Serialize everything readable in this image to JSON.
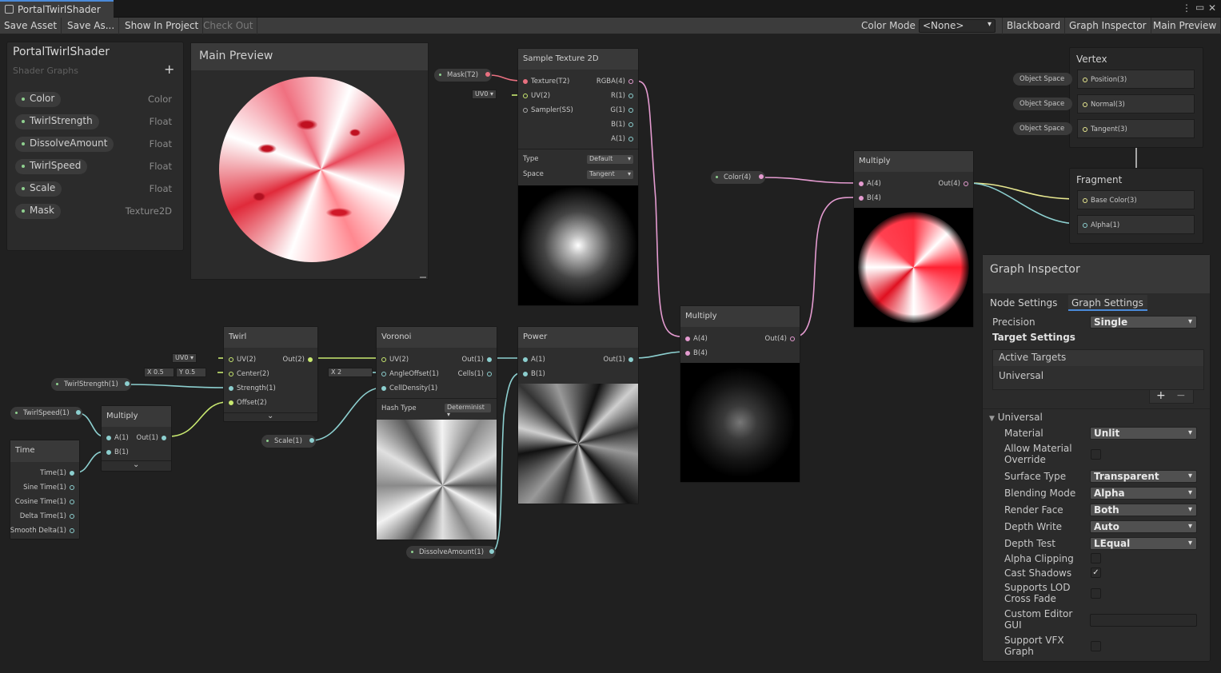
{
  "window": {
    "tab_title": "PortalTwirlShader",
    "menu_icon": "kebab-icon",
    "maximize_icon": "maximize-icon",
    "close_icon": "close-icon"
  },
  "toolbar": {
    "save_asset": "Save Asset",
    "save_as": "Save As...",
    "show_in_project": "Show In Project",
    "check_out": "Check Out",
    "color_mode_label": "Color Mode",
    "color_mode_value": "<None>",
    "blackboard": "Blackboard",
    "graph_inspector": "Graph Inspector",
    "main_preview": "Main Preview"
  },
  "blackboard": {
    "title": "PortalTwirlShader",
    "subtitle": "Shader Graphs",
    "add": "+",
    "properties": [
      {
        "name": "Color",
        "type": "Color"
      },
      {
        "name": "TwirlStrength",
        "type": "Float"
      },
      {
        "name": "DissolveAmount",
        "type": "Float"
      },
      {
        "name": "TwirlSpeed",
        "type": "Float"
      },
      {
        "name": "Scale",
        "type": "Float"
      },
      {
        "name": "Mask",
        "type": "Texture2D"
      }
    ]
  },
  "main_preview": {
    "title": "Main Preview"
  },
  "nodes": {
    "sample_texture": {
      "title": "Sample Texture 2D",
      "inputs": [
        "Texture(T2)",
        "UV(2)",
        "Sampler(SS)"
      ],
      "outputs": [
        "RGBA(4)",
        "R(1)",
        "G(1)",
        "B(1)",
        "A(1)"
      ],
      "type_label": "Type",
      "type_value": "Default",
      "space_label": "Space",
      "space_value": "Tangent"
    },
    "mask_pill": "Mask(T2)",
    "uv0_a": "UV0 ▾",
    "color_pill": "Color(4)",
    "multiply_top": {
      "title": "Multiply",
      "a": "A(4)",
      "b": "B(4)",
      "out": "Out(4)"
    },
    "vertex": {
      "title": "Vertex",
      "ports": [
        "Position(3)",
        "Normal(3)",
        "Tangent(3)"
      ],
      "space": "Object Space"
    },
    "fragment": {
      "title": "Fragment",
      "ports": [
        "Base Color(3)",
        "Alpha(1)"
      ]
    },
    "twirl": {
      "title": "Twirl",
      "inputs": [
        "UV(2)",
        "Center(2)",
        "Strength(1)",
        "Offset(2)"
      ],
      "out": "Out(2)",
      "uv0": "UV0 ▾",
      "x_label": "X",
      "x_value": "0.5",
      "y_label": "Y",
      "y_value": "0.5"
    },
    "twirl_strength_pill": "TwirlStrength(1)",
    "twirl_speed_pill": "TwirlSpeed(1)",
    "multiply_small": {
      "title": "Multiply",
      "a": "A(1)",
      "b": "B(1)",
      "out": "Out(1)"
    },
    "time": {
      "title": "Time",
      "ports": [
        "Time(1)",
        "Sine Time(1)",
        "Cosine Time(1)",
        "Delta Time(1)",
        "Smooth Delta(1)"
      ]
    },
    "voronoi": {
      "title": "Voronoi",
      "inputs": [
        "UV(2)",
        "AngleOffset(1)",
        "CellDensity(1)"
      ],
      "outputs": [
        "Out(1)",
        "Cells(1)"
      ],
      "x_label": "X",
      "x_value": "2",
      "hash_label": "Hash Type",
      "hash_value": "Determinist ▾"
    },
    "scale_pill": "Scale(1)",
    "dissolve_pill": "DissolveAmount(1)",
    "power": {
      "title": "Power",
      "a": "A(1)",
      "b": "B(1)",
      "out": "Out(1)"
    },
    "multiply_mid": {
      "title": "Multiply",
      "a": "A(4)",
      "b": "B(4)",
      "out": "Out(4)"
    }
  },
  "inspector": {
    "title": "Graph Inspector",
    "tabs": [
      "Node Settings",
      "Graph Settings"
    ],
    "precision_label": "Precision",
    "precision_value": "Single",
    "target_settings": "Target Settings",
    "active_targets": "Active Targets",
    "target_item": "Universal",
    "add": "+",
    "remove": "−",
    "section": "Universal",
    "rows": [
      {
        "label": "Material",
        "value": "Unlit"
      },
      {
        "label": "Allow Material Override",
        "checked": false
      },
      {
        "label": "Surface Type",
        "value": "Transparent"
      },
      {
        "label": "Blending Mode",
        "value": "Alpha"
      },
      {
        "label": "Render Face",
        "value": "Both"
      },
      {
        "label": "Depth Write",
        "value": "Auto"
      },
      {
        "label": "Depth Test",
        "value": "LEqual"
      },
      {
        "label": "Alpha Clipping",
        "checked": false
      },
      {
        "label": "Cast Shadows",
        "checked": true
      },
      {
        "label": "Supports LOD Cross Fade",
        "checked": false
      },
      {
        "label": "Custom Editor GUI",
        "value": ""
      },
      {
        "label": "Support VFX Graph",
        "checked": false
      }
    ],
    "check_mark": "✓"
  }
}
